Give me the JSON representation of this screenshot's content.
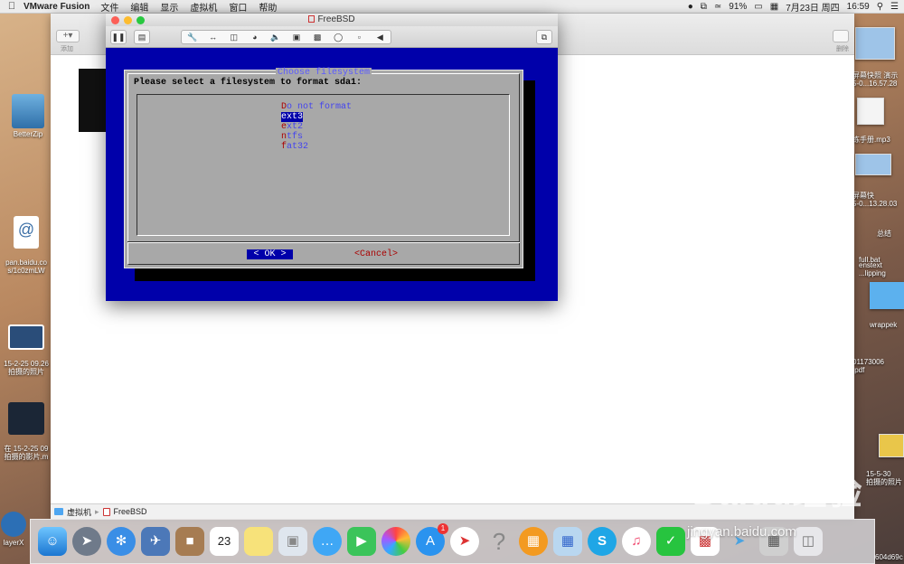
{
  "menubar": {
    "app_name": "VMware Fusion",
    "menus": [
      "文件",
      "编辑",
      "显示",
      "虚拟机",
      "窗口",
      "帮助"
    ],
    "battery": "91%",
    "datetime": "7月23日 周四",
    "time": "16:59"
  },
  "desktop_left": {
    "items": [
      {
        "label": "BetterZip"
      },
      {
        "label": "pan.baidu.co\ns/1c0zmLW"
      },
      {
        "label": "15-2-25 09.26\n拍摄的照片"
      },
      {
        "label": "在 15-2-25 09\n拍摄的影片.m"
      },
      {
        "label": "layerX"
      }
    ]
  },
  "desktop_right": {
    "items": [
      {
        "label": "屏幕快照 演示\n5-0...16.57.28"
      },
      {
        "label": "练手册.mp3"
      },
      {
        "label": "屏幕快\n5-0...13.28.03"
      },
      {
        "label": "总结"
      },
      {
        "label": "full.bat"
      },
      {
        "label": "enstext\n...lipping"
      },
      {
        "label": "wrappek"
      },
      {
        "label": "01173006\n.pdf"
      },
      {
        "label": "15-5-30\n拍摄的照片"
      },
      {
        "label": "604d69c"
      }
    ]
  },
  "library_window": {
    "add_label": "添加",
    "trash_label": "删除",
    "path": [
      "虚拟机",
      "FreeBSD"
    ]
  },
  "vm_window": {
    "title": "FreeBSD"
  },
  "dialog": {
    "title": "Choose filesystem",
    "prompt": "Please select a filesystem to format sda1:",
    "options": [
      {
        "hotkey": "D",
        "rest": "o not format",
        "selected": false
      },
      {
        "hotkey": "e",
        "rest": "xt3",
        "selected": true
      },
      {
        "hotkey": "e",
        "rest": "xt2",
        "selected": false
      },
      {
        "hotkey": "n",
        "rest": "tfs",
        "selected": false
      },
      {
        "hotkey": "f",
        "rest": "at32",
        "selected": false
      }
    ],
    "ok_label_prefix": "< ",
    "ok_hotkey": "O",
    "ok_rest": "K",
    "ok_label_suffix": " >",
    "cancel_prefix": "<",
    "cancel_hotkey": "C",
    "cancel_rest": "ancel>"
  },
  "dock": {
    "appstore_badge": "1",
    "calendar_day": "23"
  },
  "watermark": {
    "logo": "Baidu经验",
    "url": "jingyan.baidu.com"
  },
  "colors": {
    "console_blue": "#0000aa",
    "dialog_grey": "#a8a8a8",
    "hotkey_red": "#aa0000"
  }
}
